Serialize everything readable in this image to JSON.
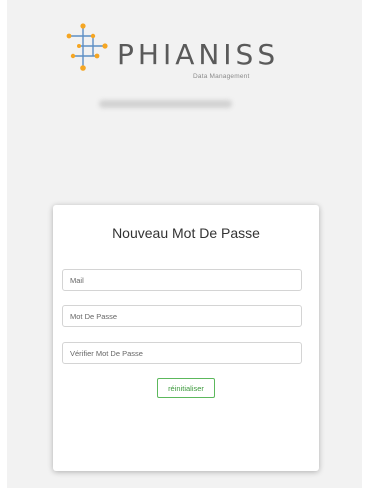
{
  "brand": {
    "name": "PHIANISS",
    "tagline": "Data Management",
    "logo_icon": "molecule-network-icon",
    "accent_color": "#f5a623",
    "line_color": "#5d8fc4"
  },
  "form": {
    "title": "Nouveau Mot De Passe",
    "mail_placeholder": "Mail",
    "password_placeholder": "Mot De Passe",
    "confirm_placeholder": "Vérifier Mot De Passe",
    "reset_label": "réinitialiser",
    "button_color": "#5cb85c"
  }
}
